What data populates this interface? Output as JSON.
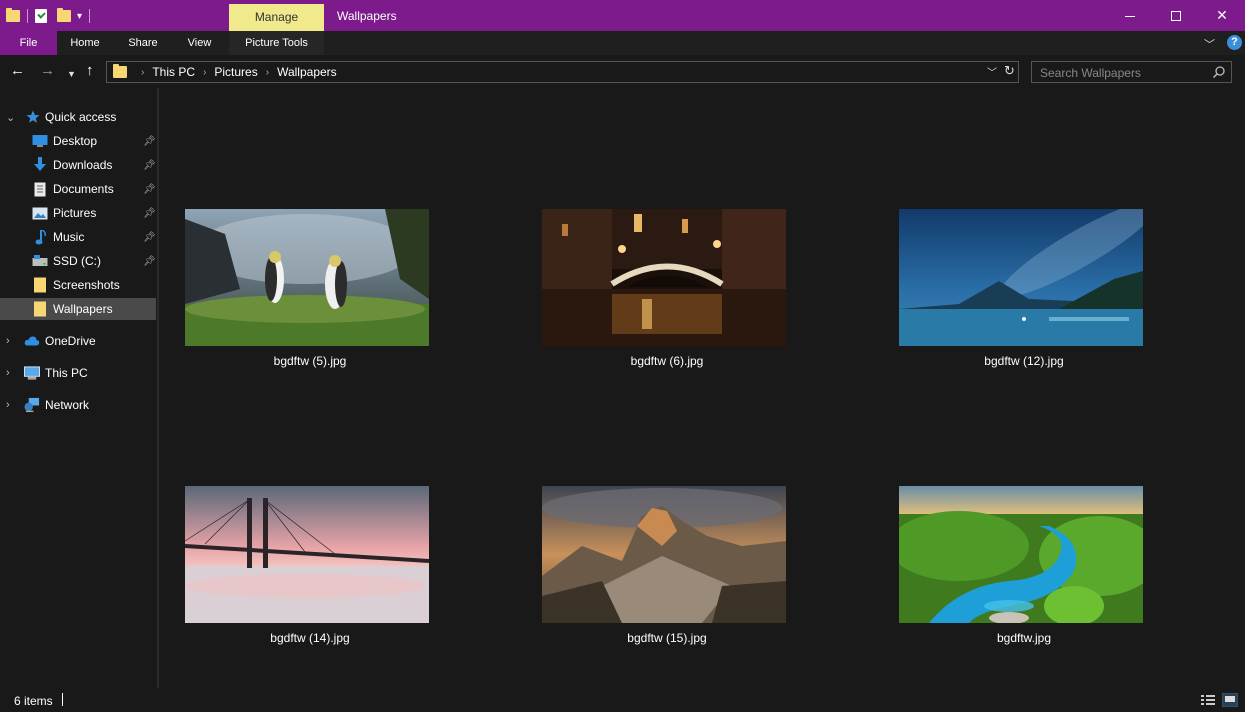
{
  "titlebar": {
    "contextual_tab": "Manage",
    "window_title": "Wallpapers",
    "background_color": "#7d1b8d"
  },
  "ribbon": {
    "tabs": [
      "File",
      "Home",
      "Share",
      "View",
      "Picture Tools"
    ],
    "help_label": "?"
  },
  "navigation": {
    "address_parts": [
      "This PC",
      "Pictures",
      "Wallpapers"
    ],
    "search_placeholder": "Search Wallpapers"
  },
  "sidebar": {
    "quick_access_label": "Quick access",
    "quick_access_items": [
      {
        "label": "Desktop",
        "icon": "desktop-icon",
        "pinned": true
      },
      {
        "label": "Downloads",
        "icon": "downloads-icon",
        "pinned": true
      },
      {
        "label": "Documents",
        "icon": "documents-icon",
        "pinned": true
      },
      {
        "label": "Pictures",
        "icon": "pictures-icon",
        "pinned": true
      },
      {
        "label": "Music",
        "icon": "music-icon",
        "pinned": true
      },
      {
        "label": "SSD (C:)",
        "icon": "drive-icon",
        "pinned": true
      },
      {
        "label": "Screenshots",
        "icon": "folder-icon",
        "pinned": false
      },
      {
        "label": "Wallpapers",
        "icon": "folder-icon",
        "pinned": false,
        "selected": true
      }
    ],
    "roots": [
      {
        "label": "OneDrive",
        "icon": "cloud-icon"
      },
      {
        "label": "This PC",
        "icon": "computer-icon"
      },
      {
        "label": "Network",
        "icon": "network-icon"
      }
    ]
  },
  "files": [
    {
      "name": "bgdftw (5).jpg",
      "scene": "penguins"
    },
    {
      "name": "bgdftw (6).jpg",
      "scene": "venice-canal-night"
    },
    {
      "name": "bgdftw (12).jpg",
      "scene": "lake-milky-way"
    },
    {
      "name": "bgdftw (14).jpg",
      "scene": "bridge-sunset"
    },
    {
      "name": "bgdftw (15).jpg",
      "scene": "mountain-peaks"
    },
    {
      "name": "bgdftw.jpg",
      "scene": "blue-river-forest"
    }
  ],
  "status": {
    "item_count": "6 items"
  }
}
